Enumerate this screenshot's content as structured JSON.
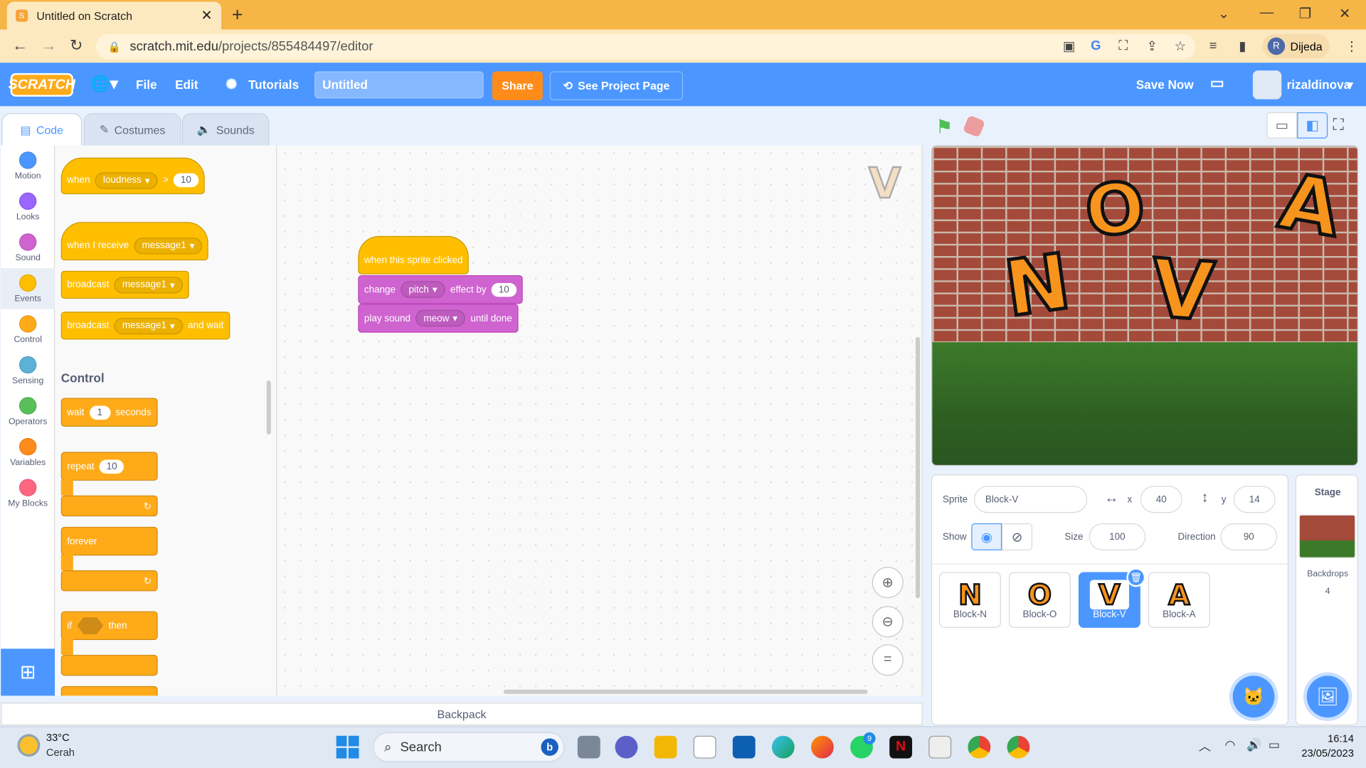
{
  "browser": {
    "tab_title": "Untitled on Scratch",
    "tab_close": "✕",
    "new_tab": "+",
    "url_host": "scratch.mit.edu",
    "url_path": "/projects/855484497/editor",
    "profile_initial": "R",
    "profile_name": "Dijeda"
  },
  "menu": {
    "logo": "SCRATCH",
    "file": "File",
    "edit": "Edit",
    "tutorials": "Tutorials",
    "project_title": "Untitled",
    "share": "Share",
    "see_project_page": "See Project Page",
    "save_now": "Save Now",
    "username": "rizaldinova"
  },
  "editor_tabs": [
    "Code",
    "Costumes",
    "Sounds"
  ],
  "categories": [
    {
      "label": "Motion",
      "color": "#4c97ff"
    },
    {
      "label": "Looks",
      "color": "#9966ff"
    },
    {
      "label": "Sound",
      "color": "#cf63cf"
    },
    {
      "label": "Events",
      "color": "#ffbf00"
    },
    {
      "label": "Control",
      "color": "#ffab19"
    },
    {
      "label": "Sensing",
      "color": "#5cb1d6"
    },
    {
      "label": "Operators",
      "color": "#59c059"
    },
    {
      "label": "Variables",
      "color": "#ff8c1a"
    },
    {
      "label": "My Blocks",
      "color": "#ff6680"
    }
  ],
  "palette": {
    "when_loudness": {
      "when": "when",
      "menu": "loudness",
      "op": ">",
      "value": "10"
    },
    "when_receive": {
      "text": "when I receive",
      "menu": "message1"
    },
    "broadcast": {
      "text": "broadcast",
      "menu": "message1"
    },
    "broadcast_wait": {
      "text": "broadcast",
      "menu": "message1",
      "suffix": "and wait"
    },
    "control_heading": "Control",
    "wait": {
      "text": "wait",
      "value": "1",
      "suffix": "seconds"
    },
    "repeat": {
      "text": "repeat",
      "value": "10"
    },
    "forever": "forever",
    "if_then": {
      "if": "if",
      "then": "then"
    }
  },
  "script": {
    "hat": "when this sprite clicked",
    "change": {
      "text": "change",
      "menu": "pitch",
      "mid": "effect by",
      "value": "10"
    },
    "play": {
      "text": "play sound",
      "menu": "meow",
      "suffix": "until done"
    },
    "sprite_watermark": "V"
  },
  "backpack": "Backpack",
  "stage_letters": [
    "N",
    "O",
    "V",
    "A"
  ],
  "sprite_info": {
    "sprite_label": "Sprite",
    "sprite_name": "Block-V",
    "x_label": "x",
    "x": "40",
    "y_label": "y",
    "y": "14",
    "show_label": "Show",
    "size_label": "Size",
    "size": "100",
    "direction_label": "Direction",
    "direction": "90"
  },
  "sprites": [
    {
      "letter": "N",
      "name": "Block-N"
    },
    {
      "letter": "O",
      "name": "Block-O"
    },
    {
      "letter": "V",
      "name": "Block-V"
    },
    {
      "letter": "A",
      "name": "Block-A"
    }
  ],
  "stage_panel": {
    "title": "Stage",
    "backdrops_label": "Backdrops",
    "backdrops_count": "4"
  },
  "taskbar": {
    "temp": "33°C",
    "weather": "Cerah",
    "search": "Search",
    "whatsapp_badge": "9",
    "time": "16:14",
    "date": "23/05/2023"
  }
}
